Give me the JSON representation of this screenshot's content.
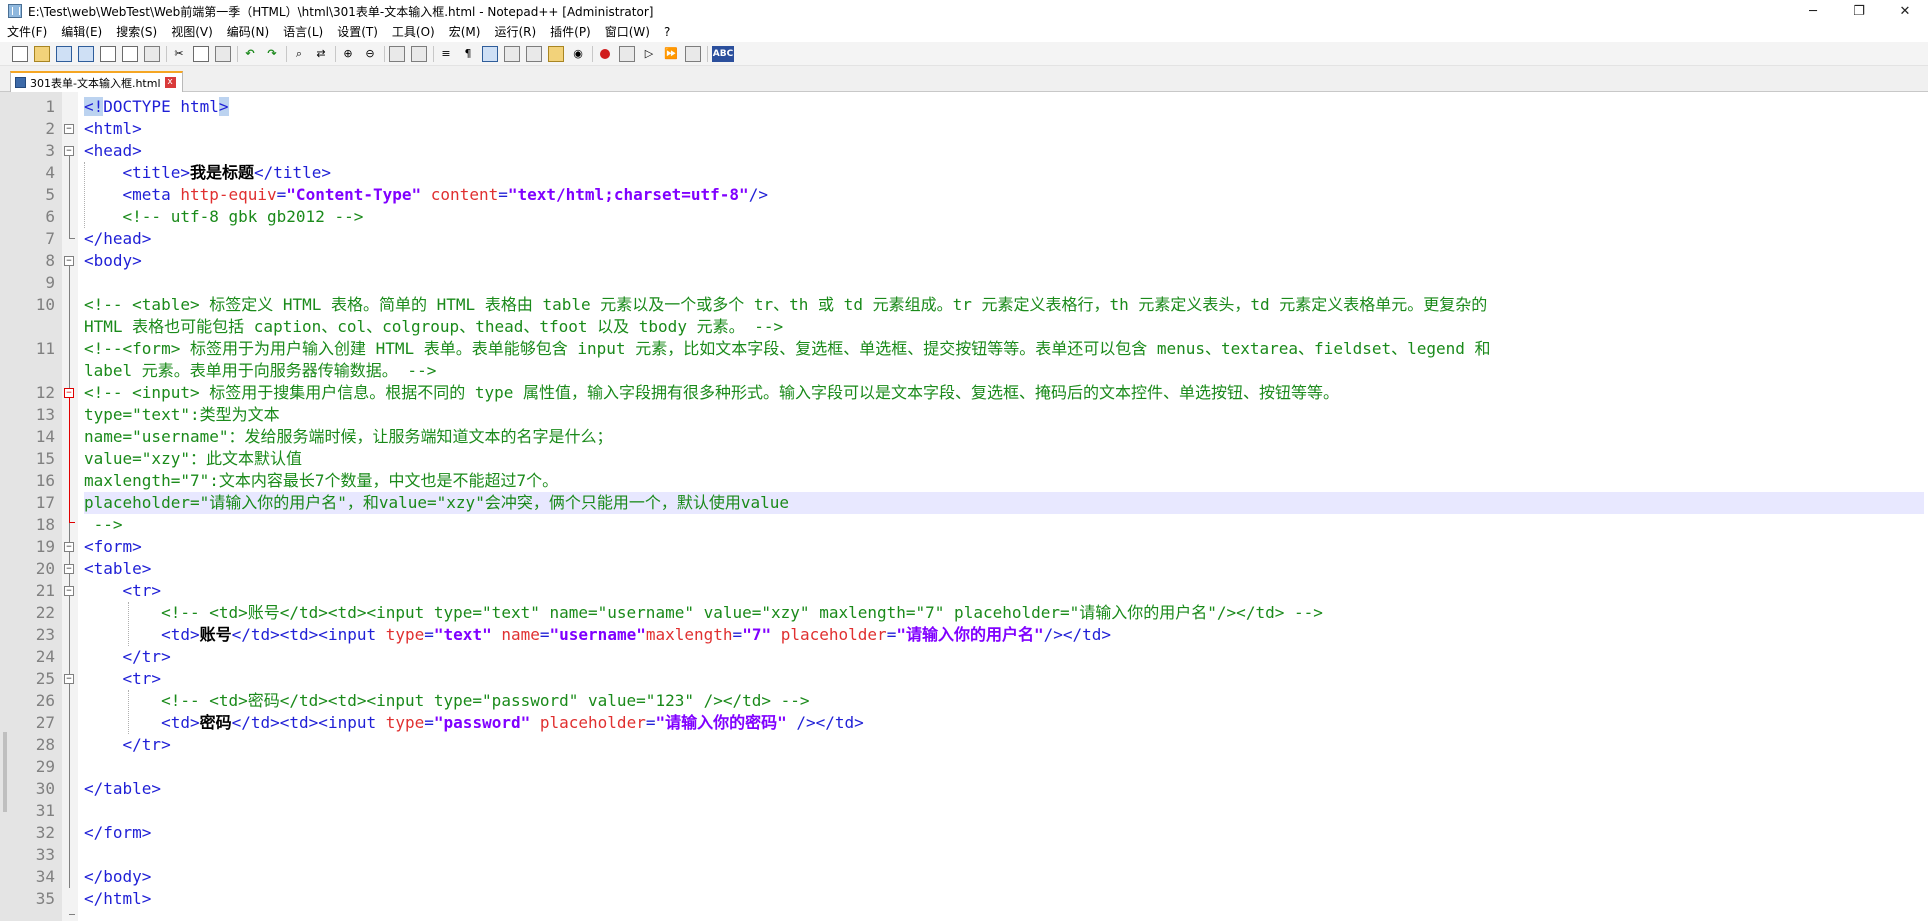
{
  "window": {
    "title": "E:\\Test\\web\\WebTest\\Web前端第一季（HTML）\\html\\301表单-文本输入框.html - Notepad++ [Administrator]",
    "minimize": "─",
    "restore": "❐",
    "close": "✕"
  },
  "menu": [
    "文件(F)",
    "编辑(E)",
    "搜索(S)",
    "视图(V)",
    "编码(N)",
    "语言(L)",
    "设置(T)",
    "工具(O)",
    "宏(M)",
    "运行(R)",
    "插件(P)",
    "窗口(W)",
    "?"
  ],
  "toolbar": {
    "icons": [
      "new-file-icon",
      "open-file-icon",
      "save-icon",
      "save-all-icon",
      "close-icon",
      "close-all-icon",
      "print-icon",
      "cut-icon",
      "copy-icon",
      "paste-icon",
      "undo-icon",
      "redo-icon",
      "find-icon",
      "replace-icon",
      "zoom-in-icon",
      "zoom-out-icon",
      "sync-vertical-icon",
      "sync-horizontal-icon",
      "word-wrap-icon",
      "show-all-chars-icon",
      "indent-guide-icon",
      "doc-map-icon",
      "function-list-icon",
      "folder-workspace-icon",
      "monitoring-icon",
      "record-macro-icon",
      "stop-record-icon",
      "playback-macro-icon",
      "run-macro-multiple-icon",
      "save-macro-icon",
      "spell-check-icon"
    ],
    "spell_label": "ABC"
  },
  "tab": {
    "label": "301表单-文本输入框.html",
    "close": "x"
  },
  "editor": {
    "current_line": 17,
    "line_numbers": [
      "1",
      "2",
      "3",
      "4",
      "5",
      "6",
      "7",
      "8",
      "9",
      "10",
      "11",
      "12",
      "13",
      "14",
      "15",
      "16",
      "17",
      "18",
      "19",
      "20",
      "21",
      "22",
      "23",
      "24",
      "25",
      "26",
      "27",
      "28",
      "29",
      "30",
      "31",
      "32",
      "33",
      "34",
      "35"
    ],
    "lines": {
      "l1_a": "<!",
      "l1_b": "DOCTYPE html",
      "l1_c": ">",
      "l2": "<html>",
      "l3": "<head>",
      "l4_open": "<title>",
      "l4_text": "我是标题",
      "l4_close": "</title>",
      "l5_tag": "<meta ",
      "l5_attr1": "http-equiv",
      "l5_eq1": "=",
      "l5_val1": "\"Content-Type\"",
      "l5_attr2": " content",
      "l5_eq2": "=",
      "l5_val2": "\"text/html;charset=utf-8\"",
      "l5_end": "/>",
      "l6": "<!-- utf-8 gbk gb2012 -->",
      "l7": "</head>",
      "l8": "<body>",
      "l10a": "<!-- <table> 标签定义 HTML 表格。简单的 HTML 表格由 table 元素以及一个或多个 tr、th 或 td 元素组成。tr 元素定义表格行，th 元素定义表头，td 元素定义表格单元。更复杂的",
      "l10b": "HTML 表格也可能包括 caption、col、colgroup、thead、tfoot 以及 tbody 元素。 -->",
      "l11a": "<!--<form> 标签用于为用户输入创建 HTML 表单。表单能够包含 input 元素，比如文本字段、复选框、单选框、提交按钮等等。表单还可以包含 menus、textarea、fieldset、legend 和",
      "l11b": "label 元素。表单用于向服务器传输数据。 -->",
      "l12": "<!-- <input> 标签用于搜集用户信息。根据不同的 type 属性值，输入字段拥有很多种形式。输入字段可以是文本字段、复选框、掩码后的文本控件、单选按钮、按钮等等。",
      "l13": "type=\"text\":类型为文本",
      "l14": "name=\"username\"：发给服务端时候，让服务端知道文本的名字是什么；",
      "l15": "value=\"xzy\"：此文本默认值",
      "l16": "maxlength=\"7\":文本内容最长7个数量，中文也是不能超过7个。",
      "l17": "placeholder=\"请输入你的用户名\"，和value=\"xzy\"会冲突，俩个只能用一个，默认使用value",
      "l18": " -->",
      "l19": "<form>",
      "l20": "<table>",
      "l21": "<tr>",
      "l22": "<!-- <td>账号</td><td><input type=\"text\" name=\"username\" value=\"xzy\" maxlength=\"7\" placeholder=\"请输入你的用户名\"/></td> -->",
      "l23_td": "<td>",
      "l23_text": "账号",
      "l23_tags": "</td><td><input ",
      "l23_a1": "type",
      "l23_e1": "=",
      "l23_v1": "\"text\"",
      "l23_a2": " name",
      "l23_e2": "=",
      "l23_v2": "\"username\"",
      "l23_a3": "maxlength",
      "l23_e3": "=",
      "l23_v3": "\"7\"",
      "l23_a4": " placeholder",
      "l23_e4": "=",
      "l23_v4": "\"请输入你的用户名\"",
      "l23_end": "/></td>",
      "l24": "</tr>",
      "l25": "<tr>",
      "l26": "<!-- <td>密码</td><td><input type=\"password\" value=\"123\" /></td> -->",
      "l27_td": "<td>",
      "l27_text": "密码",
      "l27_tags": "</td><td><input ",
      "l27_a1": "type",
      "l27_e1": "=",
      "l27_v1": "\"password\"",
      "l27_a2": " placeholder",
      "l27_e2": "=",
      "l27_v2": "\"请输入你的密码\"",
      "l27_end": " /></td>",
      "l28": "</tr>",
      "l30": "</table>",
      "l32": "</form>",
      "l34": "</body>",
      "l35": "</html>"
    }
  }
}
